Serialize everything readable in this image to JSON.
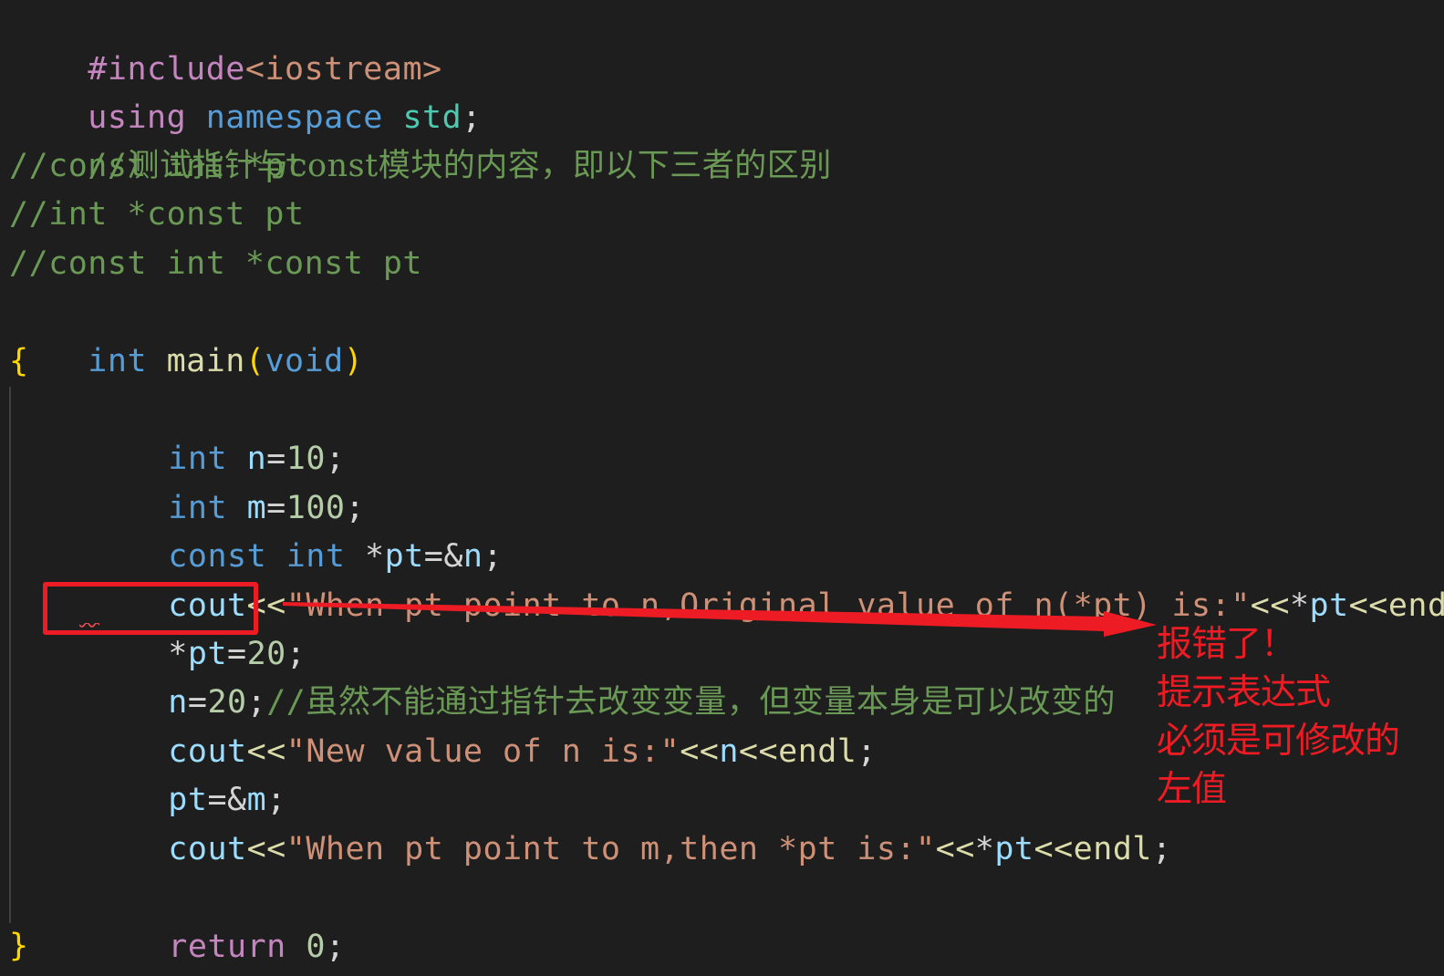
{
  "editor": {
    "lines": {
      "include": {
        "directive": "#include",
        "header": "<iostream>"
      },
      "using": {
        "kw_using": "using",
        "kw_namespace": "namespace",
        "ns": "std",
        "semi": ";"
      },
      "comment1": {
        "prefix": "//",
        "text": "测试指针与const模块的内容，即以下三者的区别"
      },
      "comment2": "//const int *pt",
      "comment3": "//int *const pt",
      "comment4": "//const int *const pt",
      "main": {
        "ret_type": "int",
        "name": "main",
        "open_paren": "(",
        "param": "void",
        "close_paren": ")"
      },
      "open_brace": "{",
      "decl_n": {
        "type": "int",
        "var": "n",
        "op": "=",
        "value": "10",
        "semi": ";"
      },
      "decl_m": {
        "type": "int",
        "var": "m",
        "op": "=",
        "value": "100",
        "semi": ";"
      },
      "decl_pt": {
        "qual": "const",
        "type": "int",
        "star": "*",
        "var": "pt",
        "op": "=&",
        "target": "n",
        "semi": ";"
      },
      "cout1": {
        "stream": "cout",
        "op1": "<<",
        "string": "\"When pt point to n,Original value of n(*pt) is:\"",
        "op2": "<<",
        "star": "*",
        "var": "pt",
        "op3": "<<",
        "endl": "endl",
        "semi": ";"
      },
      "assign_deref": {
        "star": "*",
        "var": "pt",
        "op": "=",
        "value": "20",
        "semi": ";"
      },
      "assign_n": {
        "var": "n",
        "op": "=",
        "value": "20",
        "semi": ";",
        "comment_prefix": "//",
        "comment": "虽然不能通过指针去改变变量，但变量本身是可以改变的"
      },
      "cout2": {
        "stream": "cout",
        "op1": "<<",
        "string": "\"New value of n is:\"",
        "op2": "<<",
        "var": "n",
        "op3": "<<",
        "endl": "endl",
        "semi": ";"
      },
      "reassign_pt": {
        "var": "pt",
        "op": "=&",
        "target": "m",
        "semi": ";"
      },
      "cout3": {
        "stream": "cout",
        "op1": "<<",
        "string": "\"When pt point to m,then *pt is:\"",
        "op2": "<<",
        "star": "*",
        "var": "pt",
        "op3": "<<",
        "endl": "endl",
        "semi": ";"
      },
      "return_stmt": {
        "kw": "return",
        "value": "0",
        "semi": ";"
      },
      "close_brace": "}"
    }
  },
  "annotation": {
    "color": "#ed1c24",
    "note_lines": [
      "报错了！",
      "提示表达式",
      "必须是可修改的",
      "左值"
    ]
  }
}
